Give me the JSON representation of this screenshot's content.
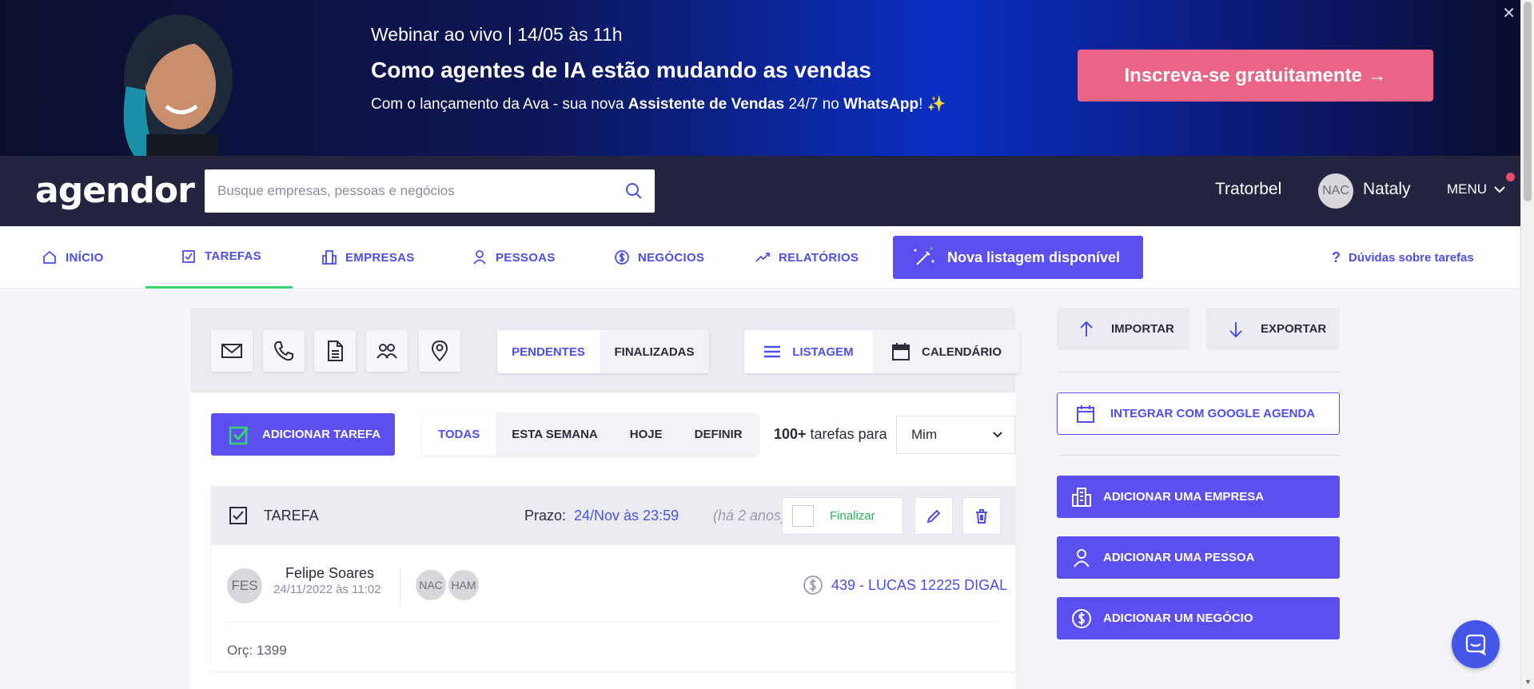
{
  "banner": {
    "eyebrow": "Webinar ao vivo | 14/05 às 11h",
    "headline": "Como agentes de IA estão mudando as vendas",
    "sub_prefix": "Com o lançamento da Ava - sua nova ",
    "sub_bold1": "Assistente de Vendas",
    "sub_mid": " 24/7 no ",
    "sub_bold2": "WhatsApp",
    "sub_suffix": "! ✨",
    "cta": "Inscreva-se gratuitamente →",
    "close_glyph": "✕"
  },
  "header": {
    "logo": "agendor",
    "search_placeholder": "Busque empresas, pessoas e negócios",
    "company": "Tratorbel",
    "user_initials": "NAC",
    "user_name": "Nataly",
    "menu_label": "MENU"
  },
  "tabs": {
    "inicio": "INÍCIO",
    "tarefas": "TAREFAS",
    "empresas": "EMPRESAS",
    "pessoas": "PESSOAS",
    "negocios": "NEGÓCIOS",
    "relatorios": "RELATÓRIOS",
    "new_list": "Nova listagem disponível",
    "help": "Dúvidas sobre tarefas"
  },
  "toolbar": {
    "status_options": [
      "PENDENTES",
      "FINALIZADAS"
    ],
    "status_selected": "PENDENTES",
    "view_options": [
      "LISTAGEM",
      "CALENDÁRIO"
    ],
    "view_selected": "LISTAGEM",
    "task_type_icons": [
      "email-icon",
      "phone-icon",
      "document-icon",
      "meeting-icon",
      "location-icon"
    ]
  },
  "filters": {
    "add_task": "ADICIONAR TAREFA",
    "periods": [
      "TODAS",
      "ESTA SEMANA",
      "HOJE",
      "DEFINIR"
    ],
    "period_selected": "TODAS",
    "count_bold": "100+",
    "count_text": " tarefas para",
    "owner": "Mim"
  },
  "task": {
    "type": "TAREFA",
    "due_label": "Prazo:",
    "due_date": "24/Nov às 23:59",
    "due_ago": "(há 2 anos)",
    "finalize": "Finalizar",
    "author_initials": "FES",
    "author_name": "Felipe Soares",
    "created": "24/11/2022 às 11:02",
    "participants": [
      "NAC",
      "HAM"
    ],
    "deal": "439 - LUCAS 12225 DIGAL",
    "note": "Orç: 1399"
  },
  "sidebar": {
    "import": "IMPORTAR",
    "export": "EXPORTAR",
    "google": "INTEGRAR COM GOOGLE AGENDA",
    "add_company": "ADICIONAR UMA EMPRESA",
    "add_person": "ADICIONAR UMA PESSOA",
    "add_deal": "ADICIONAR UM NEGÓCIO"
  },
  "colors": {
    "primary": "#5b4ff0",
    "accent_text": "#4c4fe8",
    "cta": "#ea6585",
    "success": "#36d36f",
    "topbar": "#23243f"
  }
}
